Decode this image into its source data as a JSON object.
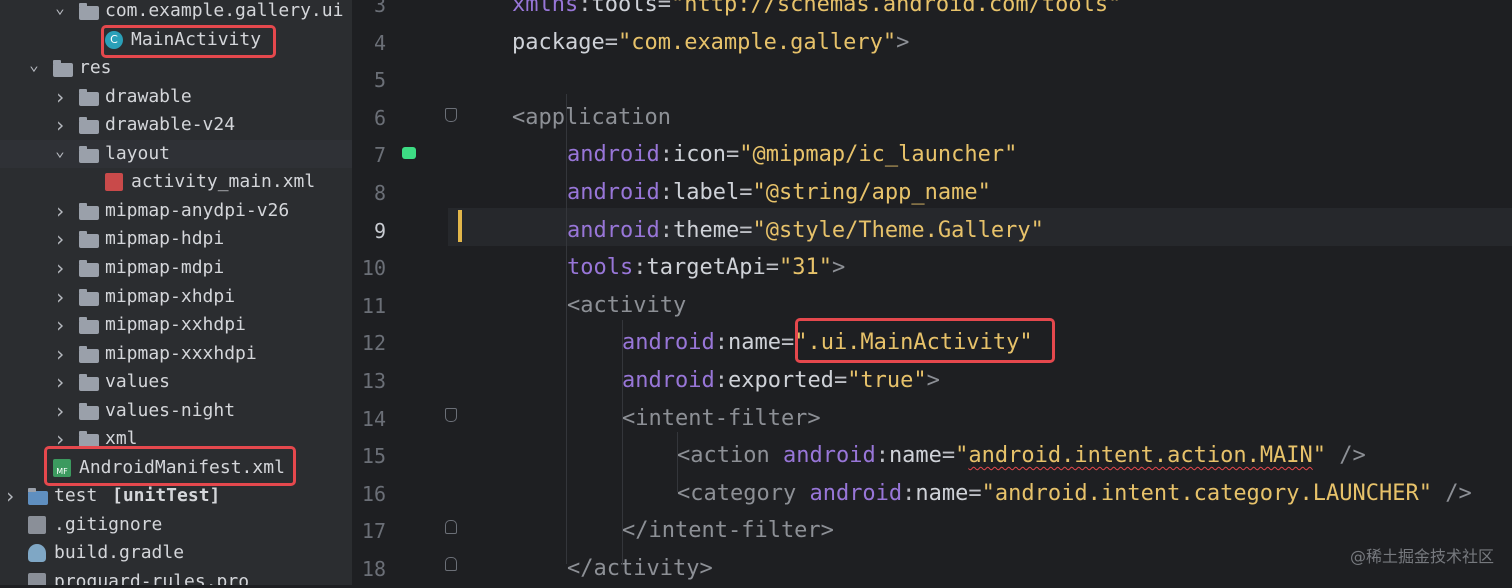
{
  "sidebar": {
    "items": [
      {
        "label": "com.example.gallery.ui",
        "icon": "folder-icon",
        "expanded": true
      },
      {
        "label": "MainActivity",
        "icon": "kotlin-class-icon"
      },
      {
        "label": "res",
        "icon": "resource-folder-icon",
        "expanded": true
      },
      {
        "label": "drawable",
        "icon": "folder-icon",
        "expanded": false
      },
      {
        "label": "drawable-v24",
        "icon": "folder-icon",
        "expanded": false
      },
      {
        "label": "layout",
        "icon": "folder-icon",
        "expanded": true
      },
      {
        "label": "activity_main.xml",
        "icon": "layout-xml-icon"
      },
      {
        "label": "mipmap-anydpi-v26",
        "icon": "folder-icon",
        "expanded": false
      },
      {
        "label": "mipmap-hdpi",
        "icon": "folder-icon",
        "expanded": false
      },
      {
        "label": "mipmap-mdpi",
        "icon": "folder-icon",
        "expanded": false
      },
      {
        "label": "mipmap-xhdpi",
        "icon": "folder-icon",
        "expanded": false
      },
      {
        "label": "mipmap-xxhdpi",
        "icon": "folder-icon",
        "expanded": false
      },
      {
        "label": "mipmap-xxxhdpi",
        "icon": "folder-icon",
        "expanded": false
      },
      {
        "label": "values",
        "icon": "folder-icon",
        "expanded": false
      },
      {
        "label": "values-night",
        "icon": "folder-icon",
        "expanded": false
      },
      {
        "label": "xml",
        "icon": "folder-icon",
        "expanded": false
      },
      {
        "label": "AndroidManifest.xml",
        "icon": "manifest-icon",
        "icon_text": "MF"
      },
      {
        "label": "test",
        "suffix": "[unitTest]",
        "icon": "test-folder-icon",
        "expanded": false
      },
      {
        "label": ".gitignore",
        "icon": "gitignore-icon"
      },
      {
        "label": "build.gradle",
        "icon": "gradle-icon"
      },
      {
        "label": "proguard-rules.pro",
        "icon": "file-icon"
      }
    ]
  },
  "editor": {
    "active_line": 9,
    "lines": [
      {
        "num": "3",
        "tokens": [
          {
            "t": "xmlns",
            "c": "ns"
          },
          {
            "t": ":",
            "c": "punct"
          },
          {
            "t": "tools",
            "c": "attr"
          },
          {
            "t": "=",
            "c": "punct"
          },
          {
            "t": "\"http://schemas.android.com/tools\"",
            "c": "val"
          }
        ]
      },
      {
        "num": "4",
        "tokens": [
          {
            "t": "package",
            "c": "attr"
          },
          {
            "t": "=",
            "c": "punct"
          },
          {
            "t": "\"com.example.gallery\"",
            "c": "val"
          },
          {
            "t": ">",
            "c": "tag"
          }
        ]
      },
      {
        "num": "5",
        "tokens": []
      },
      {
        "num": "6",
        "tokens": [
          {
            "t": "<application",
            "c": "tag"
          }
        ]
      },
      {
        "num": "7",
        "tokens": [
          {
            "t": "android",
            "c": "ns"
          },
          {
            "t": ":",
            "c": "punct"
          },
          {
            "t": "icon",
            "c": "attr"
          },
          {
            "t": "=",
            "c": "punct"
          },
          {
            "t": "\"@mipmap/ic_launcher\"",
            "c": "val"
          }
        ]
      },
      {
        "num": "8",
        "tokens": [
          {
            "t": "android",
            "c": "ns"
          },
          {
            "t": ":",
            "c": "punct"
          },
          {
            "t": "label",
            "c": "attr"
          },
          {
            "t": "=",
            "c": "punct"
          },
          {
            "t": "\"@string/app_name\"",
            "c": "val"
          }
        ]
      },
      {
        "num": "9",
        "tokens": [
          {
            "t": "android",
            "c": "ns"
          },
          {
            "t": ":",
            "c": "punct"
          },
          {
            "t": "theme",
            "c": "attr"
          },
          {
            "t": "=",
            "c": "punct"
          },
          {
            "t": "\"@style/Theme.Gallery\"",
            "c": "val"
          }
        ]
      },
      {
        "num": "10",
        "tokens": [
          {
            "t": "tools",
            "c": "ns"
          },
          {
            "t": ":",
            "c": "punct"
          },
          {
            "t": "targetApi",
            "c": "attr"
          },
          {
            "t": "=",
            "c": "punct"
          },
          {
            "t": "\"31\"",
            "c": "val"
          },
          {
            "t": ">",
            "c": "tag"
          }
        ]
      },
      {
        "num": "11",
        "tokens": [
          {
            "t": "<activity",
            "c": "tag"
          }
        ]
      },
      {
        "num": "12",
        "tokens": [
          {
            "t": "android",
            "c": "ns"
          },
          {
            "t": ":",
            "c": "punct"
          },
          {
            "t": "name",
            "c": "attr"
          },
          {
            "t": "=",
            "c": "punct"
          },
          {
            "t": "\".ui.MainActivity\"",
            "c": "val"
          }
        ]
      },
      {
        "num": "13",
        "tokens": [
          {
            "t": "android",
            "c": "ns"
          },
          {
            "t": ":",
            "c": "punct"
          },
          {
            "t": "exported",
            "c": "attr"
          },
          {
            "t": "=",
            "c": "punct"
          },
          {
            "t": "\"true\"",
            "c": "val"
          },
          {
            "t": ">",
            "c": "tag"
          }
        ]
      },
      {
        "num": "14",
        "tokens": [
          {
            "t": "<intent-filter>",
            "c": "tag"
          }
        ]
      },
      {
        "num": "15",
        "tokens": [
          {
            "t": "<action ",
            "c": "tag"
          },
          {
            "t": "android",
            "c": "ns"
          },
          {
            "t": ":",
            "c": "punct"
          },
          {
            "t": "name",
            "c": "attr"
          },
          {
            "t": "=",
            "c": "punct"
          },
          {
            "t": "\"",
            "c": "val"
          },
          {
            "t": "android.intent.action.MAIN",
            "c": "val",
            "squiggle": true
          },
          {
            "t": "\"",
            "c": "val"
          },
          {
            "t": " />",
            "c": "tag"
          }
        ]
      },
      {
        "num": "16",
        "tokens": [
          {
            "t": "<category ",
            "c": "tag"
          },
          {
            "t": "android",
            "c": "ns"
          },
          {
            "t": ":",
            "c": "punct"
          },
          {
            "t": "name",
            "c": "attr"
          },
          {
            "t": "=",
            "c": "punct"
          },
          {
            "t": "\"android.intent.category.LAUNCHER\"",
            "c": "val"
          },
          {
            "t": " />",
            "c": "tag"
          }
        ]
      },
      {
        "num": "17",
        "tokens": [
          {
            "t": "</intent-filter>",
            "c": "tag"
          }
        ]
      },
      {
        "num": "18",
        "tokens": [
          {
            "t": "</activity>",
            "c": "tag"
          }
        ]
      }
    ]
  },
  "watermark": "@稀土掘金技术社区",
  "colors": {
    "highlight_box": "#e5484d",
    "value": "#e7c26a",
    "namespace": "#9876d8",
    "change_marker": "#e2b64a",
    "android_green": "#3ddc84"
  }
}
